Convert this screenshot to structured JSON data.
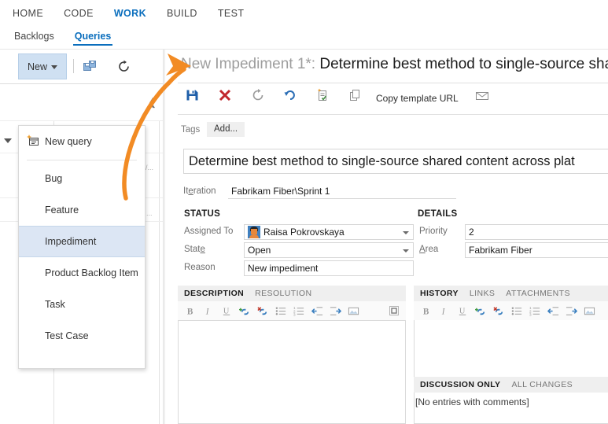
{
  "topnav": {
    "items": [
      {
        "label": "HOME",
        "active": false
      },
      {
        "label": "CODE",
        "active": false
      },
      {
        "label": "WORK",
        "active": true
      },
      {
        "label": "BUILD",
        "active": false
      },
      {
        "label": "TEST",
        "active": false
      }
    ]
  },
  "subnav": {
    "items": [
      {
        "label": "Backlogs",
        "active": false
      },
      {
        "label": "Queries",
        "active": true
      }
    ]
  },
  "left_pane": {
    "new_button": {
      "label": "New",
      "icon": "caret-down-icon"
    },
    "save_query_icon": "save-query-icon",
    "refresh_icon": "refresh-icon",
    "collapse_icon": "chevron-left-icon",
    "ghost_rows": [
      "/...",
      "...",
      "..."
    ],
    "dropdown": {
      "items": [
        {
          "label": "New query",
          "icon": "new-query-icon",
          "selected": false,
          "separator_after": true
        },
        {
          "label": "Bug",
          "selected": false
        },
        {
          "label": "Feature",
          "selected": false
        },
        {
          "label": "Impediment",
          "selected": true
        },
        {
          "label": "Product Backlog Item",
          "selected": false
        },
        {
          "label": "Task",
          "selected": false
        },
        {
          "label": "Test Case",
          "selected": false
        }
      ]
    }
  },
  "work_item": {
    "title_prefix": "New Impediment 1*: ",
    "title_text": "Determine best method to single-source shared co",
    "toolbar": {
      "save_icon": "save-icon",
      "close_icon": "close-x-icon",
      "refresh_icon": "refresh-icon",
      "revert_icon": "undo-icon",
      "templates_icon": "template-icon",
      "copy_icon": "copy-icon",
      "copy_template_url_label": "Copy template URL",
      "email_icon": "mail-icon"
    },
    "tags": {
      "label": "Tags",
      "add_label": "Add..."
    },
    "title_field": {
      "value": "Determine best method to single-source shared content across plat"
    },
    "iteration": {
      "label": "Iteration",
      "value": "Fabrikam Fiber\\Sprint 1"
    },
    "status": {
      "heading": "STATUS",
      "fields": [
        {
          "label": "Assigned To",
          "value": "Raisa Pokrovskaya",
          "avatar": true,
          "dropdown": true
        },
        {
          "label": "State",
          "label_underline": "e",
          "value": "Open",
          "dropdown": true
        },
        {
          "label": "Reason",
          "value": "New impediment",
          "dropdown": false
        }
      ]
    },
    "details": {
      "heading": "DETAILS",
      "fields": [
        {
          "label": "Priority",
          "value": "2"
        },
        {
          "label": "Area",
          "label_underline": "A",
          "value": "Fabrikam Fiber"
        }
      ]
    },
    "description_panel": {
      "tabs": [
        {
          "label": "DESCRIPTION",
          "active": true
        },
        {
          "label": "RESOLUTION",
          "active": false
        }
      ],
      "toolbar_icons": [
        "bold-icon",
        "italic-icon",
        "underline-icon",
        "add-link-icon",
        "remove-link-icon",
        "bulleted-list-icon",
        "numbered-list-icon",
        "decrease-indent-icon",
        "increase-indent-icon",
        "insert-image-icon"
      ],
      "maximize_icon": "maximize-icon",
      "content": ""
    },
    "history_panel": {
      "tabs": [
        {
          "label": "HISTORY",
          "active": true
        },
        {
          "label": "LINKS",
          "active": false
        },
        {
          "label": "ATTACHMENTS",
          "active": false
        }
      ],
      "toolbar_icons": [
        "bold-icon",
        "italic-icon",
        "underline-icon",
        "add-link-icon",
        "remove-link-icon",
        "bulleted-list-icon",
        "numbered-list-icon",
        "decrease-indent-icon",
        "increase-indent-icon",
        "insert-image-icon"
      ],
      "subtabs": [
        {
          "label": "DISCUSSION ONLY",
          "active": true
        },
        {
          "label": "ALL CHANGES",
          "active": false
        }
      ],
      "empty_message": "[No entries with comments]"
    }
  },
  "annotation": {
    "arrow": "orange-curved-arrow",
    "color": "#F28B24"
  },
  "colors": {
    "accent_blue": "#0a6ebd",
    "selection_blue": "#dce6f4",
    "button_blue": "#cfe0f2",
    "arrow_orange": "#F28B24",
    "save_blue": "#1F5FA9",
    "close_red": "#C1272D"
  }
}
